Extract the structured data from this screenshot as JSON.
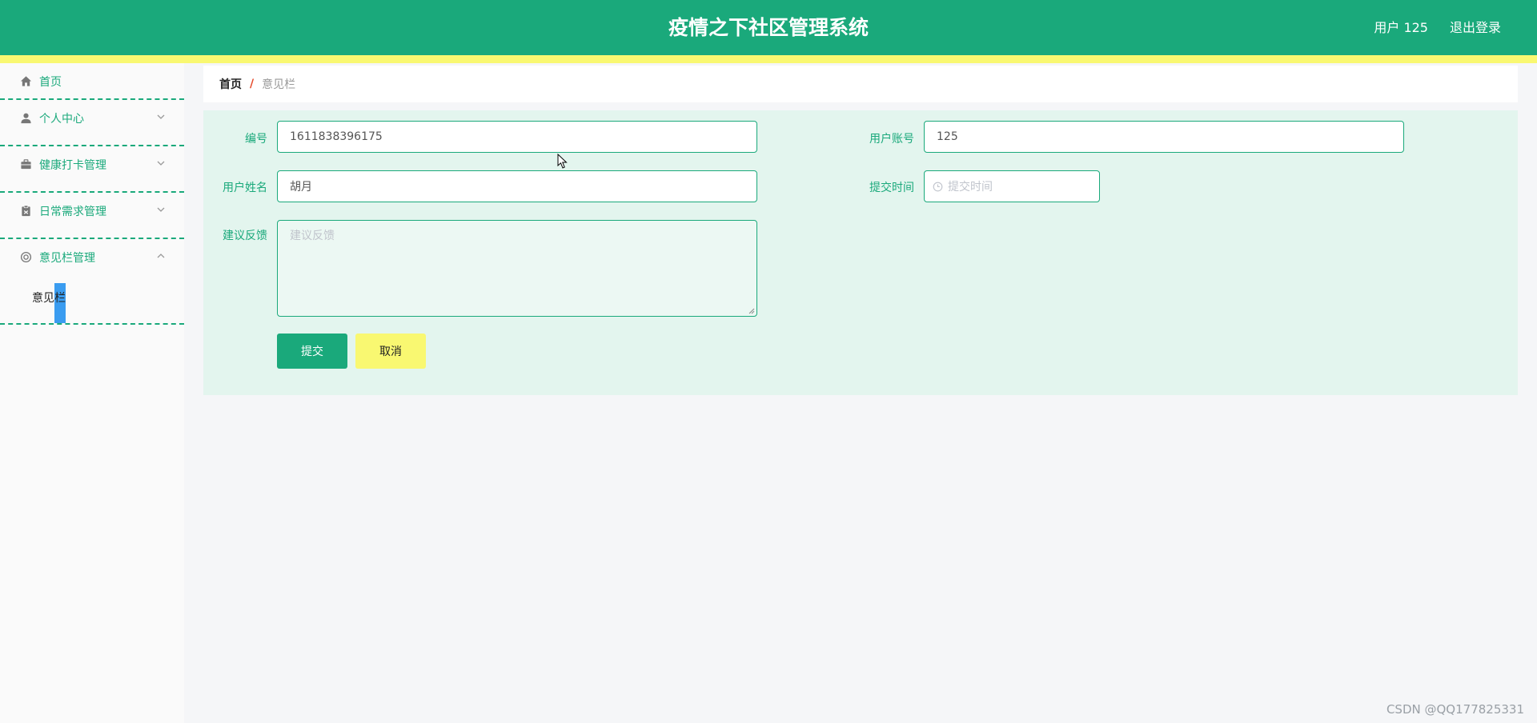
{
  "header": {
    "title": "疫情之下社区管理系统",
    "user_label": "用户 125",
    "logout_label": "退出登录"
  },
  "sidebar": {
    "items": [
      {
        "label": "首页",
        "icon": "home-icon"
      },
      {
        "label": "个人中心",
        "icon": "user-icon"
      },
      {
        "label": "健康打卡管理",
        "icon": "briefcase-icon"
      },
      {
        "label": "日常需求管理",
        "icon": "clipboard-icon"
      },
      {
        "label": "意见栏管理",
        "icon": "lifebuoy-icon"
      }
    ],
    "submenu": {
      "label": "意见栏"
    }
  },
  "breadcrumb": {
    "home": "首页",
    "separator": "/",
    "current": "意见栏"
  },
  "form": {
    "id_label": "编号",
    "id_value": "1611838396175",
    "account_label": "用户账号",
    "account_value": "125",
    "name_label": "用户姓名",
    "name_value": "胡月",
    "time_label": "提交时间",
    "time_placeholder": "提交时间",
    "feedback_label": "建议反馈",
    "feedback_placeholder": "建议反馈",
    "submit_label": "提交",
    "cancel_label": "取消"
  },
  "watermark": "CSDN @QQ177825331",
  "colors": {
    "primary": "#1aa97b",
    "accent_yellow": "#f9f871",
    "panel_bg": "#e3f5ee",
    "breadcrumb_sep": "#e54a2b"
  }
}
